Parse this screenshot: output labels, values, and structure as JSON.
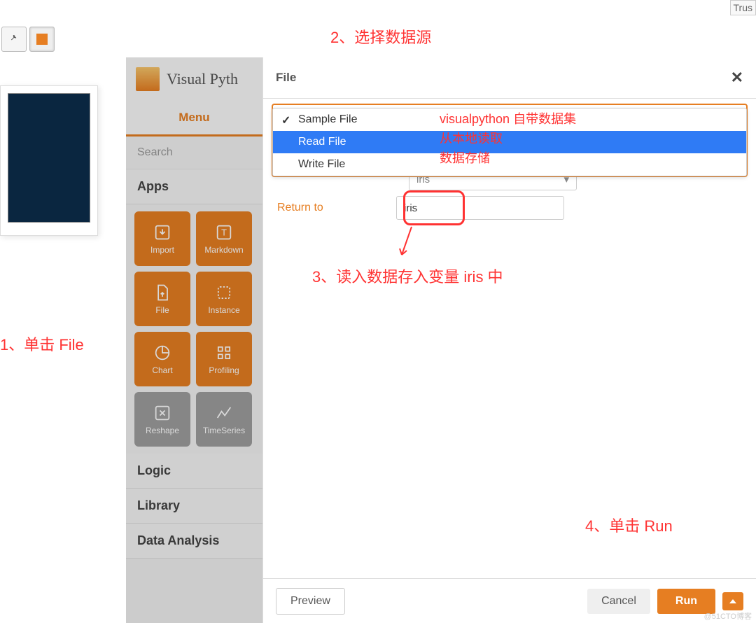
{
  "top_corner": "Trus",
  "annotations": {
    "a1": "1、单击 File",
    "a2": "2、选择数据源",
    "a3": "3、读入数据存入变量 iris 中",
    "a4": "4、单击 Run",
    "dd1": "visualpython 自带数据集",
    "dd2": "从本地读取",
    "dd3": "数据存储"
  },
  "vp": {
    "title": "Visual Pyth",
    "menu": "Menu",
    "search": "Search",
    "sections": {
      "apps": "Apps",
      "logic": "Logic",
      "library": "Library",
      "data": "Data Analysis"
    },
    "apps": {
      "import": "Import",
      "markdown": "Markdown",
      "file": "File",
      "instance": "Instance",
      "chart": "Chart",
      "profiling": "Profiling",
      "reshape": "Reshape",
      "timeseries": "TimeSeries"
    }
  },
  "dialog": {
    "title": "File",
    "dropdown": {
      "sample": "Sample File",
      "read": "Read File",
      "write": "Write File"
    },
    "ghost_select": "iris",
    "return_label": "Return to",
    "return_value": "iris",
    "preview": "Preview",
    "cancel": "Cancel",
    "run": "Run"
  },
  "watermark": "@51CTO博客"
}
